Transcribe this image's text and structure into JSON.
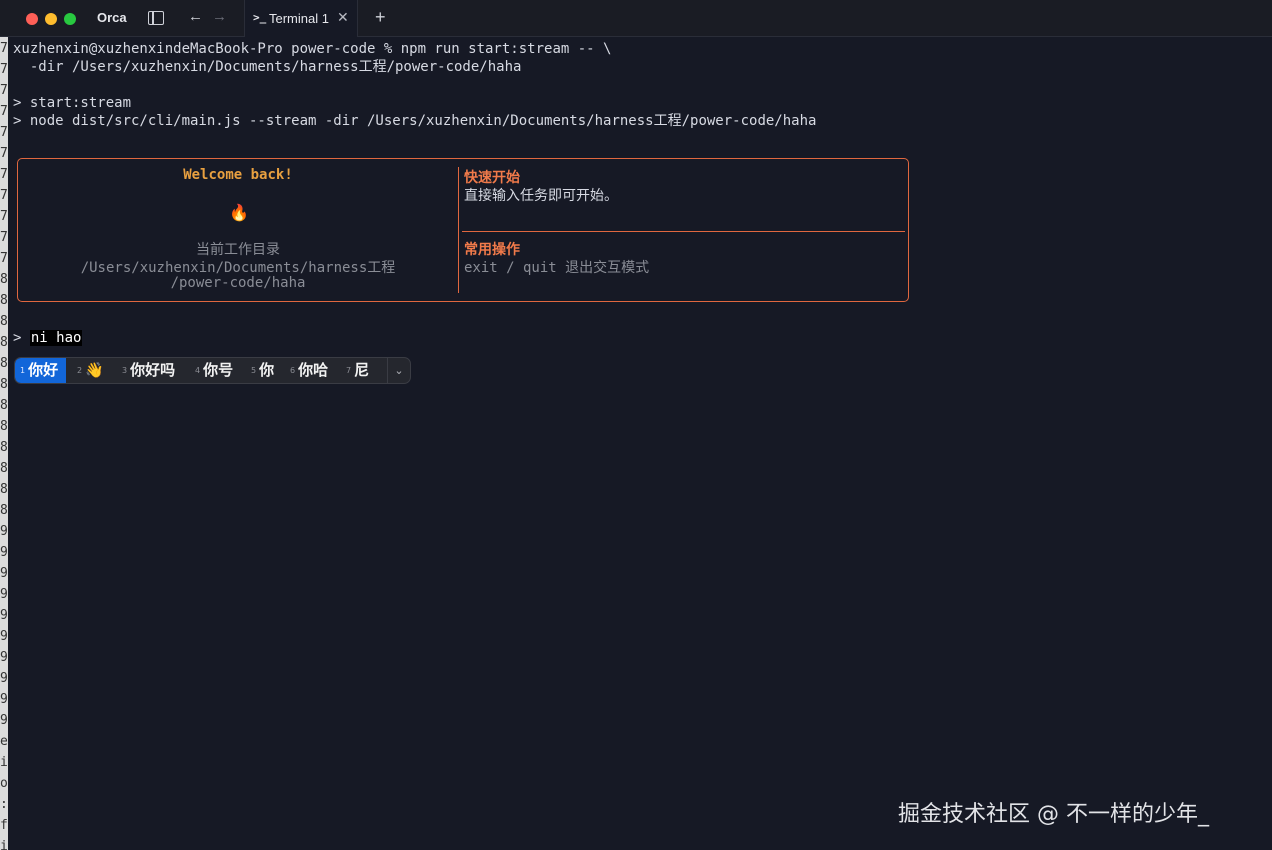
{
  "window": {
    "app_name": "Orca",
    "tab_label": "Terminal 1",
    "tab_icon": ">_",
    "close_glyph": "✕",
    "new_tab_glyph": "+",
    "back_glyph": "←",
    "forward_glyph": "→"
  },
  "terminal": {
    "cmd_line1": "xuzhenxin@xuzhenxindeMacBook-Pro power-code % npm run start:stream -- \\",
    "cmd_line2": "  -dir /Users/xuzhenxin/Documents/harness工程/power-code/haha",
    "out_line1": "> start:stream",
    "out_line2": "> node dist/src/cli/main.js --stream -dir /Users/xuzhenxin/Documents/harness工程/power-code/haha"
  },
  "panel": {
    "welcome": "Welcome back!",
    "flame": "🔥",
    "cwd_label": "当前工作目录",
    "cwd_line1": "/Users/xuzhenxin/Documents/harness工程",
    "cwd_line2": "/power-code/haha",
    "quickstart_title": "快速开始",
    "quickstart_text": "直接输入任务即可开始。",
    "ops_title": "常用操作",
    "ops_text": "exit / quit 退出交互模式"
  },
  "prompt": {
    "symbol": ">",
    "input": "ni hao"
  },
  "ime": {
    "candidates": [
      {
        "num": "1",
        "text": "你好"
      },
      {
        "num": "2",
        "text": "👋"
      },
      {
        "num": "3",
        "text": "你好吗"
      },
      {
        "num": "4",
        "text": "你号"
      },
      {
        "num": "5",
        "text": "你"
      },
      {
        "num": "6",
        "text": "你哈"
      },
      {
        "num": "7",
        "text": "尼"
      }
    ],
    "expand_glyph": "⌄"
  },
  "gutter_chars": [
    "7",
    "7",
    "7",
    "7",
    "7",
    "7",
    "7",
    "7",
    "7",
    "7",
    "7",
    "8",
    "8",
    "8",
    "8",
    "8",
    "8",
    "8",
    "8",
    "8",
    "8",
    "8",
    "8",
    "9",
    "9",
    "9",
    "9",
    "9",
    "9",
    "9",
    "9",
    "9",
    "9",
    "e",
    "i",
    "o",
    ":",
    "f",
    "i"
  ],
  "watermark": "掘金技术社区 @ 不一样的少年_"
}
